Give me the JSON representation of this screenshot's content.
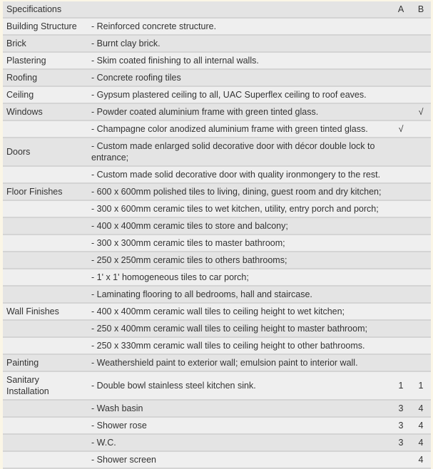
{
  "table": {
    "header": {
      "label": "Specifications",
      "col_a": "A",
      "col_b": "B"
    },
    "rows": [
      {
        "category": "Building Structure",
        "description": "- Reinforced concrete structure.",
        "a": "",
        "b": ""
      },
      {
        "category": "Brick",
        "description": "- Burnt clay brick.",
        "a": "",
        "b": ""
      },
      {
        "category": "Plastering",
        "description": "- Skim coated finishing to all internal walls.",
        "a": "",
        "b": ""
      },
      {
        "category": "Roofing",
        "description": "- Concrete roofing tiles",
        "a": "",
        "b": ""
      },
      {
        "category": "Ceiling",
        "description": "- Gypsum plastered ceiling to all, UAC Superflex ceiling to roof eaves.",
        "a": "",
        "b": ""
      },
      {
        "category": "Windows",
        "description": "- Powder coated aluminium frame with green tinted glass.",
        "a": "",
        "b": "√"
      },
      {
        "category": "",
        "description": "- Champagne color anodized aluminium frame with green tinted glass.",
        "a": "√",
        "b": ""
      },
      {
        "category": "Doors",
        "description": "- Custom made enlarged solid decorative door with décor double lock to entrance;",
        "a": "",
        "b": ""
      },
      {
        "category": "",
        "description": "- Custom made solid decorative door with quality ironmongery to the rest.",
        "a": "",
        "b": ""
      },
      {
        "category": "Floor Finishes",
        "description": "- 600 x 600mm polished tiles to living, dining, guest room and dry kitchen;",
        "a": "",
        "b": ""
      },
      {
        "category": "",
        "description": "- 300 x 600mm ceramic tiles to wet kitchen, utility, entry porch and porch;",
        "a": "",
        "b": ""
      },
      {
        "category": "",
        "description": "- 400 x 400mm ceramic tiles to store and balcony;",
        "a": "",
        "b": ""
      },
      {
        "category": "",
        "description": "- 300 x 300mm ceramic tiles to master bathroom;",
        "a": "",
        "b": ""
      },
      {
        "category": "",
        "description": "- 250 x 250mm ceramic tiles to others bathrooms;",
        "a": "",
        "b": ""
      },
      {
        "category": "",
        "description": "- 1' x 1' homogeneous tiles to car porch;",
        "a": "",
        "b": ""
      },
      {
        "category": "",
        "description": "- Laminating flooring to all bedrooms, hall and staircase.",
        "a": "",
        "b": ""
      },
      {
        "category": "Wall Finishes",
        "description": "- 400 x 400mm ceramic wall tiles to ceiling height to wet kitchen;",
        "a": "",
        "b": ""
      },
      {
        "category": "",
        "description": "- 250 x 400mm ceramic wall tiles to ceiling height to master  bathroom;",
        "a": "",
        "b": ""
      },
      {
        "category": "",
        "description": "- 250 x 330mm ceramic wall tiles to ceiling height to other bathrooms.",
        "a": "",
        "b": ""
      },
      {
        "category": "Painting",
        "description": "- Weathershield paint to exterior wall; emulsion paint to interior wall.",
        "a": "",
        "b": ""
      },
      {
        "category": "Sanitary Installation",
        "description": "- Double bowl stainless steel kitchen sink.",
        "a": "1",
        "b": "1"
      },
      {
        "category": "",
        "description": "- Wash basin",
        "a": "3",
        "b": "4"
      },
      {
        "category": "",
        "description": "- Shower rose",
        "a": "3",
        "b": "4"
      },
      {
        "category": "",
        "description": "- W.C.",
        "a": "3",
        "b": "4"
      },
      {
        "category": "",
        "description": "- Shower screen",
        "a": "",
        "b": "4"
      }
    ]
  }
}
